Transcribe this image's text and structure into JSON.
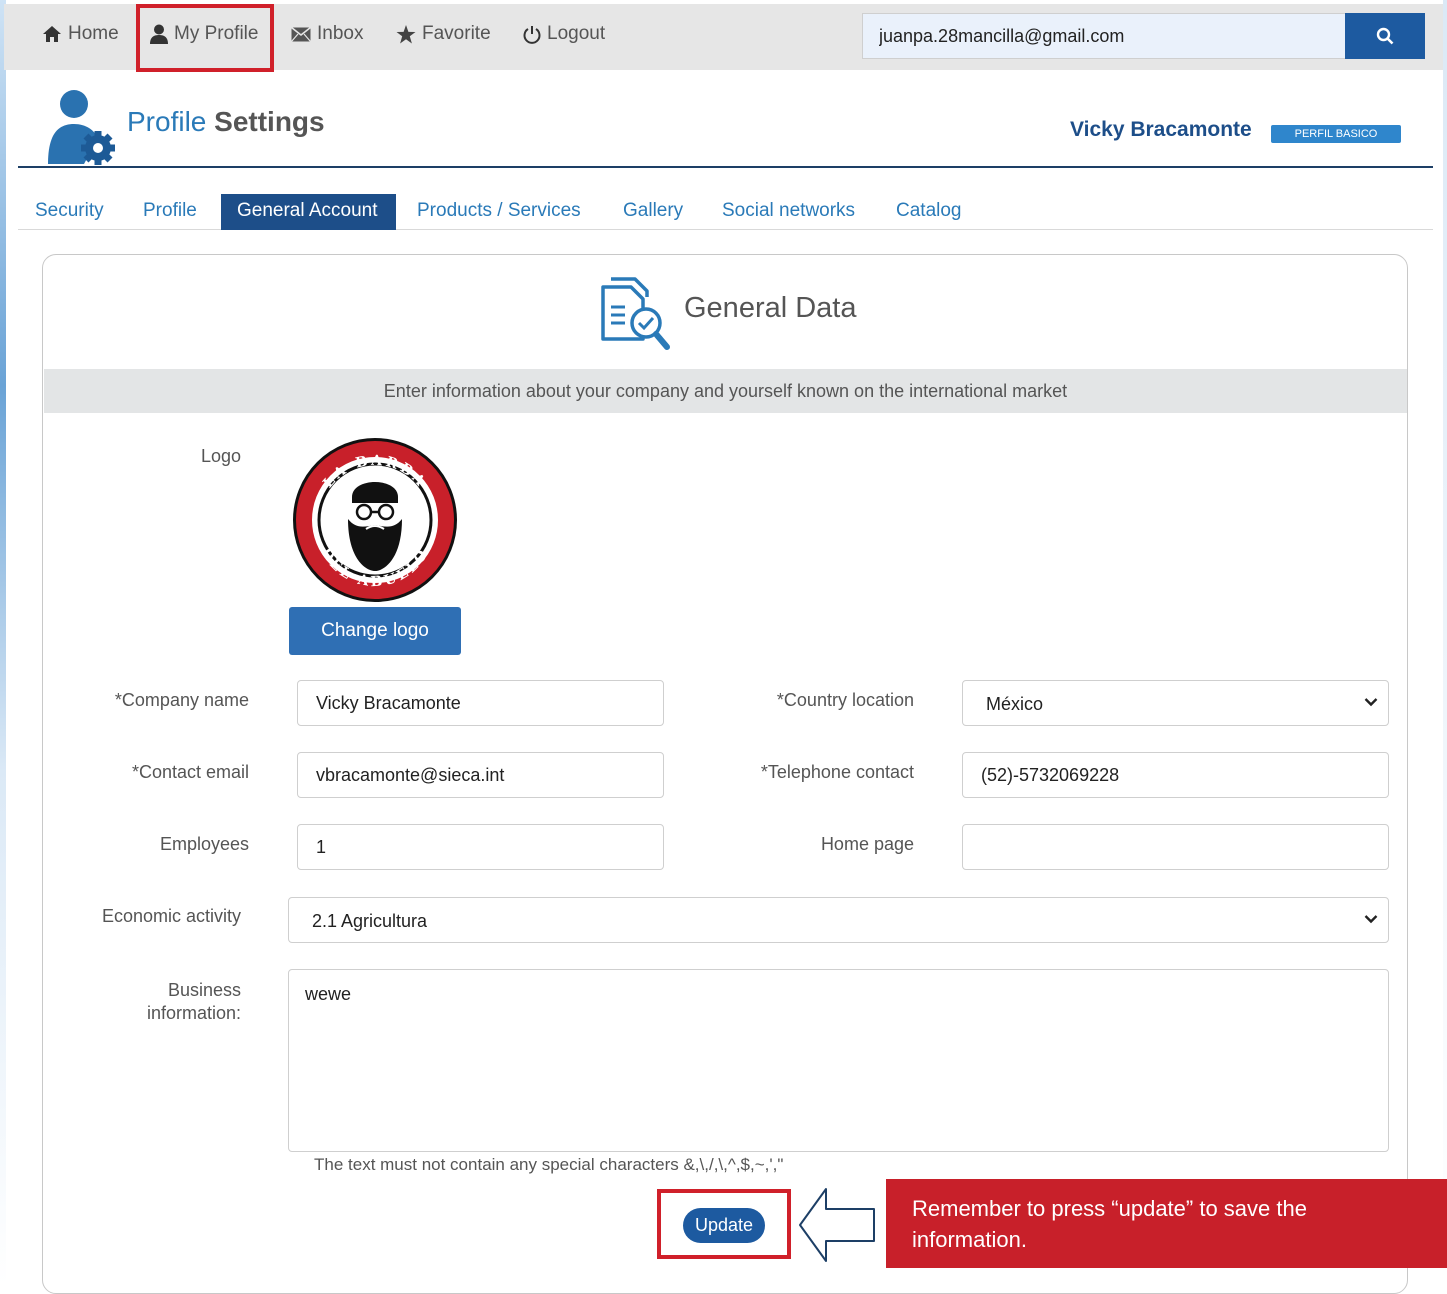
{
  "nav": {
    "home": "Home",
    "my_profile": "My Profile",
    "inbox": "Inbox",
    "favorite": "Favorite",
    "logout": "Logout"
  },
  "search": {
    "value": "juanpa.28mancilla@gmail.com"
  },
  "header": {
    "title_part1": "Profile",
    "title_part2": "Settings",
    "user_name": "Vicky Bracamonte",
    "badge": "PERFIL BASICO"
  },
  "tabs": [
    "Security",
    "Profile",
    "General Account",
    "Products / Services",
    "Gallery",
    "Social networks",
    "Catalog"
  ],
  "active_tab": "General Account",
  "card": {
    "title": "General Data",
    "info": "Enter information about your company and yourself known on the international market"
  },
  "logo": {
    "label": "Logo",
    "text_top": "LA BARBA",
    "text_bottom": "DEL ABUELO",
    "change_button": "Change logo"
  },
  "form": {
    "company_name": {
      "label": "*Company name",
      "value": "Vicky Bracamonte"
    },
    "country": {
      "label": "*Country location",
      "value": "México"
    },
    "contact_email": {
      "label": "*Contact email",
      "value": "vbracamonte@sieca.int"
    },
    "telephone": {
      "label": "*Telephone contact",
      "value": "(52)-5732069228"
    },
    "employees": {
      "label": "Employees",
      "value": "1"
    },
    "home_page": {
      "label": "Home page",
      "value": ""
    },
    "economic_activity": {
      "label": "Economic activity",
      "value": "2.1 Agricultura"
    },
    "business_info": {
      "label_line1": "Business",
      "label_line2": "information:",
      "value": "wewe"
    },
    "hint": "The text must not contain any special characters &,\\,/,\\,^,$,~,',\""
  },
  "update_button": "Update",
  "callout": "Remember to press “update” to save the information.",
  "colors": {
    "highlight_red": "#d0202a",
    "primary_blue": "#1d5aa0",
    "link_blue": "#2a7ab8",
    "callout_red": "#c8202a"
  }
}
